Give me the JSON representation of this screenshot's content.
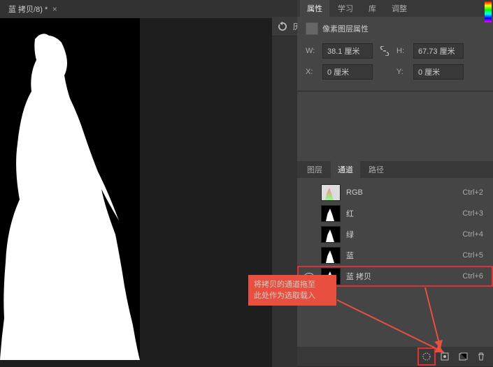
{
  "doc_tab": {
    "title": "蓝 拷贝/8) *"
  },
  "history_panel": {
    "label": "历..."
  },
  "properties": {
    "tabs": [
      "属性",
      "学习",
      "库",
      "调整"
    ],
    "active": 0,
    "title": "像素图层属性",
    "width": {
      "label": "W:",
      "value": "38.1 厘米"
    },
    "height": {
      "label": "H:",
      "value": "67.73 厘米"
    },
    "x": {
      "label": "X:",
      "value": "0 厘米"
    },
    "y": {
      "label": "Y:",
      "value": "0 厘米"
    }
  },
  "channels_panel": {
    "tabs": [
      "图层",
      "通道",
      "路径"
    ],
    "active": 1,
    "rows": [
      {
        "name": "RGB",
        "shortcut": "Ctrl+2",
        "visible": false,
        "thumb": "rgb"
      },
      {
        "name": "红",
        "shortcut": "Ctrl+3",
        "visible": false,
        "thumb": "bw"
      },
      {
        "name": "绿",
        "shortcut": "Ctrl+4",
        "visible": false,
        "thumb": "bw"
      },
      {
        "name": "蓝",
        "shortcut": "Ctrl+5",
        "visible": false,
        "thumb": "bw"
      },
      {
        "name": "蓝 拷贝",
        "shortcut": "Ctrl+6",
        "visible": true,
        "thumb": "bw",
        "selected": true
      }
    ]
  },
  "tooltip": {
    "line1": "将拷贝的通道拖至",
    "line2": "此处作为选取载入"
  }
}
